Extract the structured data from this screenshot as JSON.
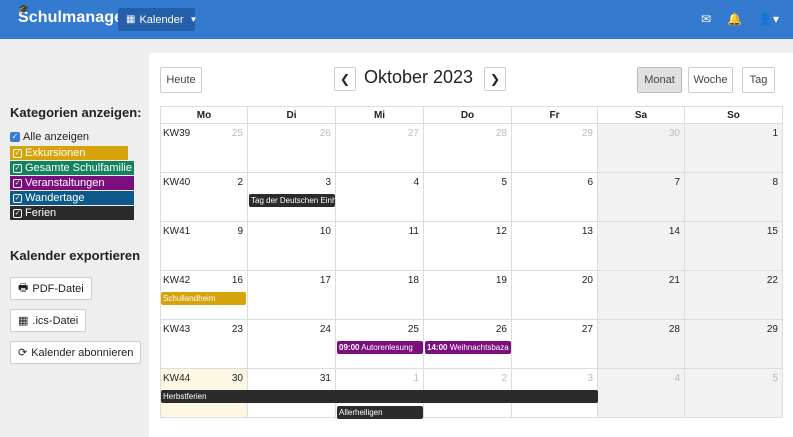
{
  "navbar": {
    "brand": "Schulmanager",
    "calendar_menu": "Kalender"
  },
  "sidebar": {
    "categories_heading": "Kategorien anzeigen:",
    "all_label": "Alle anzeigen",
    "categories": [
      {
        "label": "Exkursionen",
        "color": "#d6a40a"
      },
      {
        "label": "Gesamte Schulfamilie",
        "color": "#13825f"
      },
      {
        "label": "Veranstaltungen",
        "color": "#7b0e7e"
      },
      {
        "label": "Wandertage",
        "color": "#0d5a8a"
      },
      {
        "label": "Ferien",
        "color": "#2b2b2b"
      }
    ],
    "export_heading": "Kalender exportieren",
    "pdf_button": "PDF-Datei",
    "ics_button": ".ics-Datei",
    "subscribe_button": "Kalender abonnieren"
  },
  "header": {
    "today_button": "Heute",
    "title": "Oktober 2023",
    "view_month": "Monat",
    "view_week": "Woche",
    "view_day": "Tag"
  },
  "weekdays": [
    "Mo",
    "Di",
    "Mi",
    "Do",
    "Fr",
    "Sa",
    "So"
  ],
  "weeks": [
    {
      "kw": "KW39",
      "days": [
        "25",
        "26",
        "27",
        "28",
        "29",
        "30",
        "1"
      ]
    },
    {
      "kw": "KW40",
      "days": [
        "2",
        "3",
        "4",
        "5",
        "6",
        "7",
        "8"
      ]
    },
    {
      "kw": "KW41",
      "days": [
        "9",
        "10",
        "11",
        "12",
        "13",
        "14",
        "15"
      ]
    },
    {
      "kw": "KW42",
      "days": [
        "16",
        "17",
        "18",
        "19",
        "20",
        "21",
        "22"
      ]
    },
    {
      "kw": "KW43",
      "days": [
        "23",
        "24",
        "25",
        "26",
        "27",
        "28",
        "29"
      ]
    },
    {
      "kw": "KW44",
      "days": [
        "30",
        "31",
        "1",
        "2",
        "3",
        "4",
        "5"
      ]
    }
  ],
  "events": {
    "einheit": {
      "title": "Tag der Deutschen Einh",
      "color": "#2b2b2b"
    },
    "schullandheim": {
      "title": "Schullandheim",
      "color": "#d6a40a"
    },
    "autorenlesung": {
      "time": "09:00",
      "title": "Autorenlesung",
      "color": "#7b0e7e"
    },
    "weihnachtsbazar": {
      "time": "14:00",
      "title": "Weihnachtsbaza",
      "color": "#7b0e7e"
    },
    "herbstferien": {
      "title": "Herbstferien",
      "color": "#2b2b2b"
    },
    "allerheiligen": {
      "title": "Allerheiligen",
      "color": "#2b2b2b"
    }
  }
}
